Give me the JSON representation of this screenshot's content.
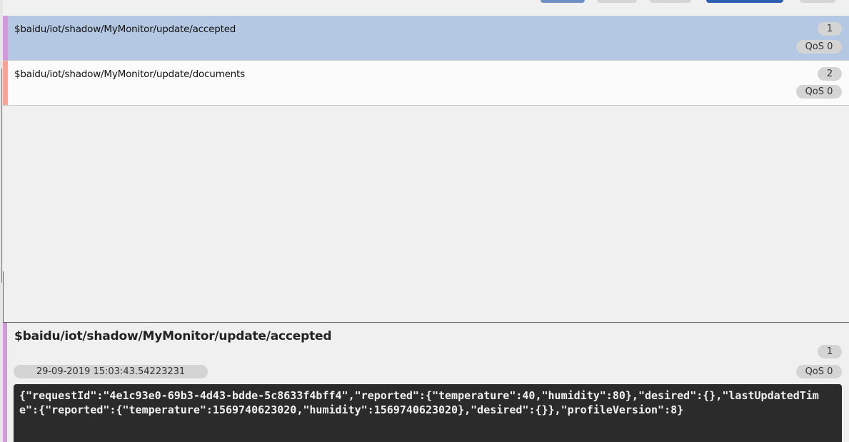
{
  "messages": [
    {
      "topic": "$baidu/iot/shadow/MyMonitor/update/accepted",
      "count": "1",
      "qos": "QoS 0",
      "selected": true
    },
    {
      "topic": "$baidu/iot/shadow/MyMonitor/update/documents",
      "count": "2",
      "qos": "QoS 0",
      "selected": false
    }
  ],
  "detail": {
    "topic": "$baidu/iot/shadow/MyMonitor/update/accepted",
    "count": "1",
    "timestamp": "29-09-2019  15:03:43.54223231",
    "qos": "QoS 0",
    "payload": "{\"requestId\":\"4e1c93e0-69b3-4d43-bdde-5c8633f4bff4\",\"reported\":{\"temperature\":40,\"humidity\":80},\"desired\":{},\"lastUpdatedTime\":{\"reported\":{\"temperature\":1569740623020,\"humidity\":1569740623020},\"desired\":{}},\"profileVersion\":8}"
  },
  "colors": {
    "selected_row": "#b4c7e3",
    "stripe_topic_1": "#cf9ad8",
    "stripe_topic_2": "#f2a49a",
    "payload_background": "#2b2b2b"
  }
}
